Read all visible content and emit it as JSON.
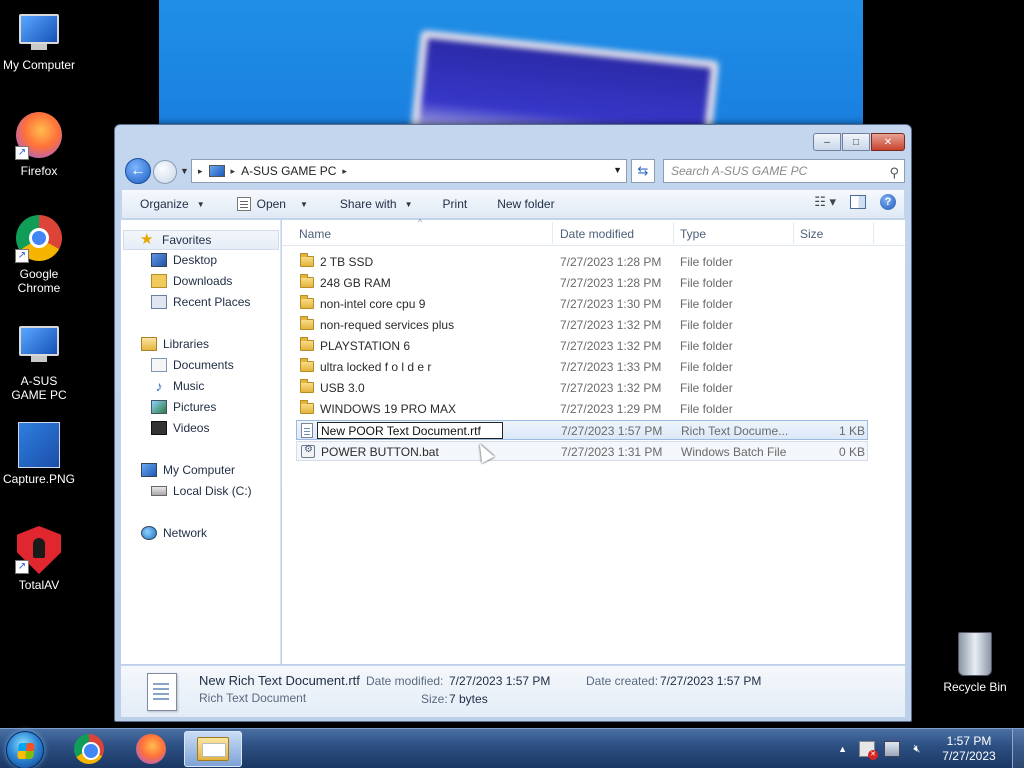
{
  "desktop": {
    "icons": [
      {
        "label": "My Computer",
        "icon": "monitor-icon"
      },
      {
        "label": "Firefox",
        "icon": "firefox-icon"
      },
      {
        "label": "Google Chrome",
        "icon": "chrome-icon"
      },
      {
        "label": "A-SUS GAME PC",
        "icon": "monitor-icon"
      },
      {
        "label": "Capture.PNG",
        "icon": "image-file-icon"
      },
      {
        "label": "TotalAV",
        "icon": "totalav-shield-icon"
      },
      {
        "label": "Recycle Bin",
        "icon": "recycle-bin-icon"
      }
    ]
  },
  "window": {
    "controls": {
      "minimize": "–",
      "maximize": "□",
      "close": "✕"
    },
    "address": {
      "path": "A-SUS GAME PC",
      "separator": "▸"
    },
    "search": {
      "placeholder": "Search A-SUS GAME PC"
    },
    "toolbar": {
      "organize": "Organize",
      "open": "Open",
      "share_with": "Share with",
      "print": "Print",
      "new_folder": "New folder"
    },
    "nav": {
      "favorites": "Favorites",
      "desktop": "Desktop",
      "downloads": "Downloads",
      "recent_places": "Recent Places",
      "libraries": "Libraries",
      "documents": "Documents",
      "music": "Music",
      "pictures": "Pictures",
      "videos": "Videos",
      "my_computer": "My Computer",
      "local_disk": "Local Disk (C:)",
      "network": "Network"
    },
    "columns": {
      "name": "Name",
      "date_modified": "Date modified",
      "type": "Type",
      "size": "Size"
    },
    "files": [
      {
        "name": "2 TB SSD",
        "date": "7/27/2023 1:28 PM",
        "type": "File folder",
        "size": ""
      },
      {
        "name": "248 GB RAM",
        "date": "7/27/2023 1:28 PM",
        "type": "File folder",
        "size": ""
      },
      {
        "name": "non-intel core cpu 9",
        "date": "7/27/2023 1:30 PM",
        "type": "File folder",
        "size": ""
      },
      {
        "name": "non-requed services plus",
        "date": "7/27/2023 1:32 PM",
        "type": "File folder",
        "size": ""
      },
      {
        "name": "PLAYSTATION 6",
        "date": "7/27/2023 1:32 PM",
        "type": "File folder",
        "size": ""
      },
      {
        "name": "ultra locked f o l d e r",
        "date": "7/27/2023 1:33 PM",
        "type": "File folder",
        "size": ""
      },
      {
        "name": "USB 3.0",
        "date": "7/27/2023 1:32 PM",
        "type": "File folder",
        "size": ""
      },
      {
        "name": "WINDOWS 19 PRO MAX",
        "date": "7/27/2023 1:29 PM",
        "type": "File folder",
        "size": ""
      },
      {
        "name": "New POOR Text Document.rtf",
        "date": "7/27/2023 1:57 PM",
        "type": "Rich Text Docume...",
        "size": "1 KB"
      },
      {
        "name": "POWER BUTTON.bat",
        "date": "7/27/2023 1:31 PM",
        "type": "Windows Batch File",
        "size": "0 KB"
      }
    ],
    "details": {
      "filename": "New Rich Text Document.rtf",
      "filetype": "Rich Text Document",
      "date_modified_label": "Date modified:",
      "date_modified": "7/27/2023 1:57 PM",
      "date_created_label": "Date created:",
      "date_created": "7/27/2023 1:57 PM",
      "size_label": "Size:",
      "size": "7 bytes"
    }
  },
  "taskbar": {
    "clock_time": "1:57 PM",
    "clock_date": "7/27/2023",
    "apps": [
      "chrome-icon",
      "firefox-icon",
      "explorer-folder-icon"
    ]
  }
}
